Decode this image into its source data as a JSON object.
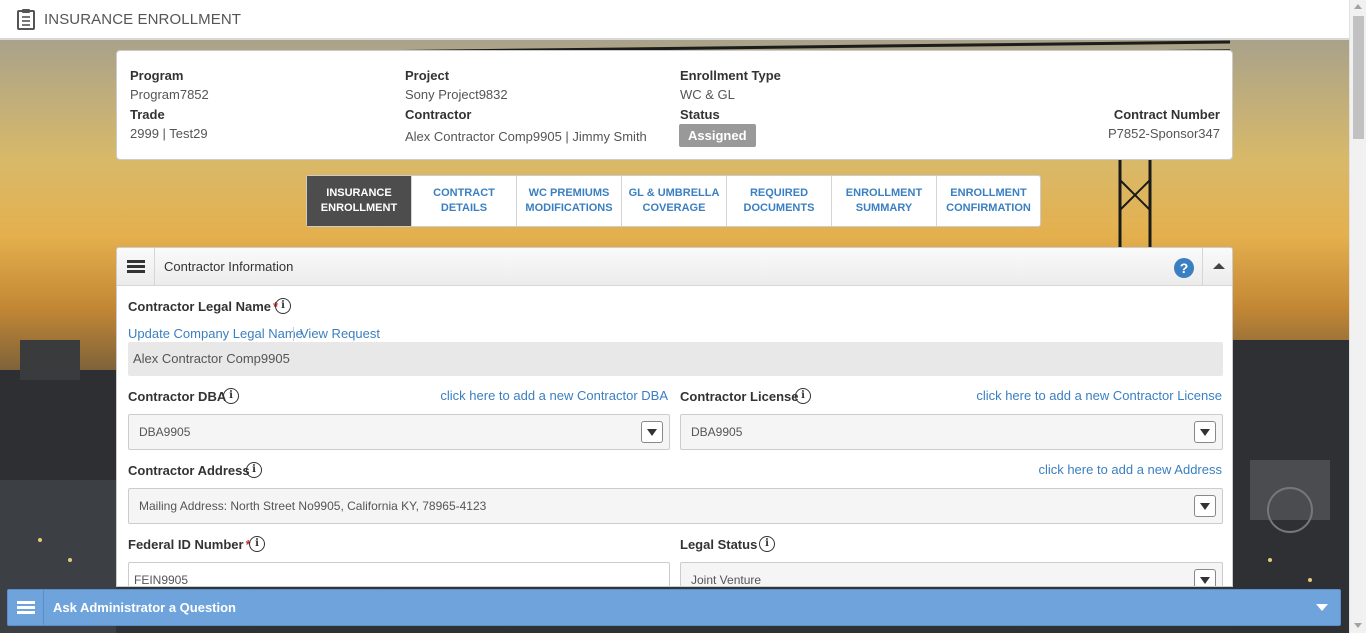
{
  "header": {
    "title": "INSURANCE ENROLLMENT",
    "icon": "clipboard-icon"
  },
  "summary": {
    "program_label": "Program",
    "program_value": "Program7852",
    "trade_label": "Trade",
    "trade_value": "2999 | Test29",
    "project_label": "Project",
    "project_value": "Sony Project9832",
    "contractor_label": "Contractor",
    "contractor_value": "Alex Contractor Comp9905 | Jimmy Smith",
    "enrollment_type_label": "Enrollment Type",
    "enrollment_type_value": "WC & GL",
    "status_label": "Status",
    "status_value": "Assigned",
    "contract_number_label": "Contract Number",
    "contract_number_value": "P7852-Sponsor347"
  },
  "tabs": [
    {
      "line1": "INSURANCE",
      "line2": "ENROLLMENT",
      "active": true
    },
    {
      "line1": "CONTRACT",
      "line2": "DETAILS",
      "active": false
    },
    {
      "line1": "WC PREMIUMS",
      "line2": "MODIFICATIONS",
      "active": false
    },
    {
      "line1": "GL & UMBRELLA",
      "line2": "COVERAGE",
      "active": false
    },
    {
      "line1": "REQUIRED",
      "line2": "DOCUMENTS",
      "active": false
    },
    {
      "line1": "ENROLLMENT",
      "line2": "SUMMARY",
      "active": false
    },
    {
      "line1": "ENROLLMENT",
      "line2": "CONFIRMATION",
      "active": false
    }
  ],
  "panel": {
    "title": "Contractor Information",
    "help_icon_glyph": "?",
    "legal_name_label": "Contractor Legal Name",
    "required_mark": "*",
    "info_glyph": "i",
    "update_link": "Update Company Legal Name",
    "view_request_link": "View Request",
    "legal_name_value": "Alex Contractor Comp9905",
    "dba_label": "Contractor DBA",
    "dba_add_link": "click here to add a new Contractor DBA",
    "dba_value": "DBA9905",
    "license_label": "Contractor License",
    "license_add_link": "click here to add a new Contractor License",
    "license_value": "DBA9905",
    "address_label": "Contractor Address",
    "address_add_link": "click here to add a new Address",
    "address_value": "Mailing Address: North Street No9905, California KY, 78965-4123",
    "federal_id_label": "Federal ID Number",
    "federal_id_value": "FEIN9905",
    "legal_status_label": "Legal Status",
    "legal_status_value": "Joint Venture"
  },
  "ask_bar": {
    "title": "Ask Administrator a Question"
  },
  "colors": {
    "accent": "#3a7fc1",
    "active_tab": "#4d4d4d",
    "ask_bar": "#6fa3dc",
    "required": "#c9302c"
  }
}
